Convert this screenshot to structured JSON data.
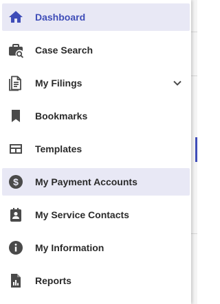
{
  "colors": {
    "accent": "#3f4db8",
    "icon": "#4a4a4a",
    "highlight": "#e8e8f5",
    "text": "#2a2a2a"
  },
  "menu": {
    "items": [
      {
        "label": "Dashboard",
        "icon": "home-icon",
        "state": "active"
      },
      {
        "label": "Case Search",
        "icon": "briefcase-search-icon"
      },
      {
        "label": "My Filings",
        "icon": "document-icon",
        "expandable": true,
        "expand_icon": "chevron-down-icon"
      },
      {
        "label": "Bookmarks",
        "icon": "bookmark-icon"
      },
      {
        "label": "Templates",
        "icon": "template-icon"
      },
      {
        "label": "My Payment Accounts",
        "icon": "dollar-circle-icon",
        "state": "highlighted"
      },
      {
        "label": "My Service Contacts",
        "icon": "contact-card-icon"
      },
      {
        "label": "My Information",
        "icon": "info-icon"
      },
      {
        "label": "Reports",
        "icon": "report-icon"
      }
    ]
  }
}
